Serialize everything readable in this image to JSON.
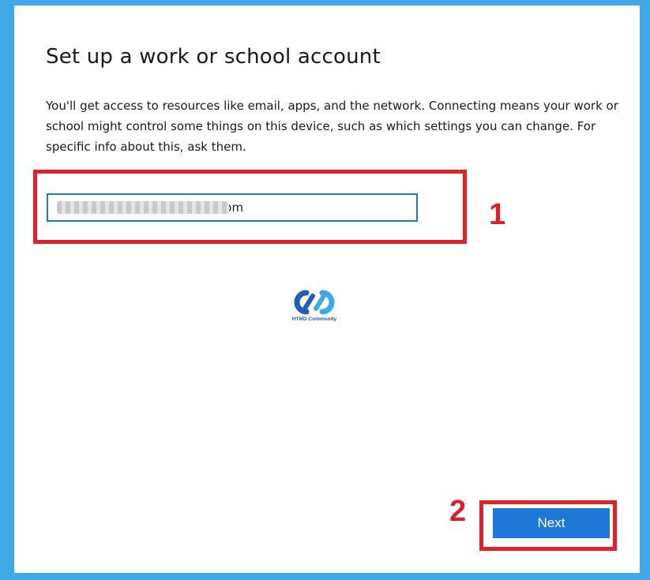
{
  "page": {
    "title": "Set up a work or school account",
    "description": "You'll get access to resources like email, apps, and the network. Connecting means your work or school might control some things on this device, such as which settings you can change. For specific info about this, ask them."
  },
  "email_field": {
    "value": "                                           com"
  },
  "annotations": {
    "step1": "1",
    "step2": "2"
  },
  "watermark": {
    "text": "HTMD Community"
  },
  "actions": {
    "next_label": "Next"
  },
  "colors": {
    "background": "#3fa9e8",
    "highlight": "#e0202a",
    "button": "#1e78d7",
    "input_border": "#2b74c4"
  }
}
